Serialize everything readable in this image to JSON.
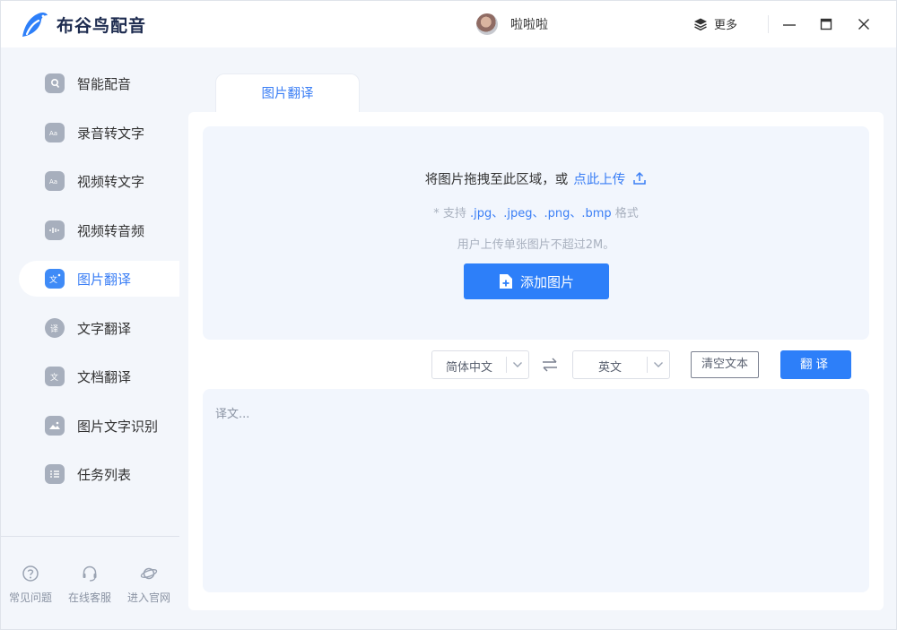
{
  "app": {
    "name": "布谷鸟配音",
    "brand_color": "#2d7ff9",
    "logo_icon": "bird-logo-icon"
  },
  "header": {
    "username": "啦啦啦",
    "more_label": "更多",
    "window_controls": [
      "minimize-icon",
      "maximize-icon",
      "close-icon"
    ]
  },
  "sidebar": {
    "items": [
      {
        "label": "智能配音",
        "icon": "microphone-icon",
        "active": false
      },
      {
        "label": "录音转文字",
        "icon": "audio-text-icon",
        "active": false
      },
      {
        "label": "视频转文字",
        "icon": "video-text-icon",
        "active": false
      },
      {
        "label": "视频转音频",
        "icon": "video-audio-icon",
        "active": false
      },
      {
        "label": "图片翻译",
        "icon": "image-translate-icon",
        "active": true
      },
      {
        "label": "文字翻译",
        "icon": "text-translate-icon",
        "active": false
      },
      {
        "label": "文档翻译",
        "icon": "document-translate-icon",
        "active": false
      },
      {
        "label": "图片文字识别",
        "icon": "image-ocr-icon",
        "active": false
      },
      {
        "label": "任务列表",
        "icon": "task-list-icon",
        "active": false
      }
    ],
    "footer": [
      {
        "label": "常见问题",
        "icon": "question-icon"
      },
      {
        "label": "在线客服",
        "icon": "headset-icon"
      },
      {
        "label": "进入官网",
        "icon": "planet-icon"
      }
    ]
  },
  "main": {
    "tab_label": "图片翻译",
    "dropzone": {
      "prompt": "将图片拖拽至此区域，或",
      "upload_link": "点此上传",
      "formats_prefix": "* 支持",
      "formats_exts": ".jpg、.jpeg、.png、.bmp",
      "formats_suffix": "格式",
      "limit_text": "用户上传单张图片不超过2M。",
      "add_button": "添加图片"
    },
    "controls": {
      "source_lang": "简体中文",
      "target_lang": "英文",
      "clear_button": "清空文本",
      "translate_button": "翻译"
    },
    "output_placeholder": "译文..."
  }
}
